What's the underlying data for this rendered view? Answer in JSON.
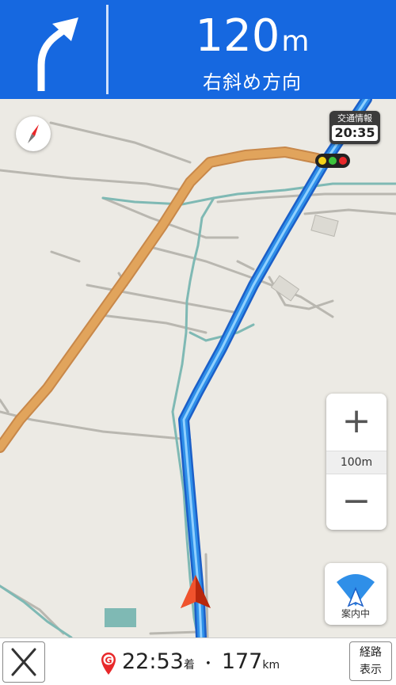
{
  "header": {
    "distance_value": "120",
    "distance_unit": "m",
    "direction": "右斜め方向",
    "turn_icon": "arrow-bear-right-icon",
    "background_color": "#1668e0"
  },
  "map": {
    "traffic_label": "交通情報",
    "traffic_time": "20:35",
    "signal_colors": [
      "#f4d21a",
      "#3cc43c",
      "#e8282a"
    ],
    "route_color": "#2f8fe8",
    "highway_color": "#e1a45c",
    "river_color": "#7fb9b4",
    "compass_icon": "compass-icon",
    "vehicle_icon": "vehicle-arrow-icon"
  },
  "zoom": {
    "plus_label": "+",
    "minus_label": "−",
    "scale": "100m"
  },
  "guide_button": {
    "label": "案内中",
    "icon": "guidance-fan-icon"
  },
  "bottom_bar": {
    "close_icon": "close-icon",
    "goal_icon": "goal-pin-icon",
    "goal_letter": "G",
    "arrival_time": "22:53",
    "arrival_suffix": "着",
    "separator": "・",
    "distance_value": "177",
    "distance_unit": "km",
    "route_line1": "経路",
    "route_line2": "表示"
  }
}
